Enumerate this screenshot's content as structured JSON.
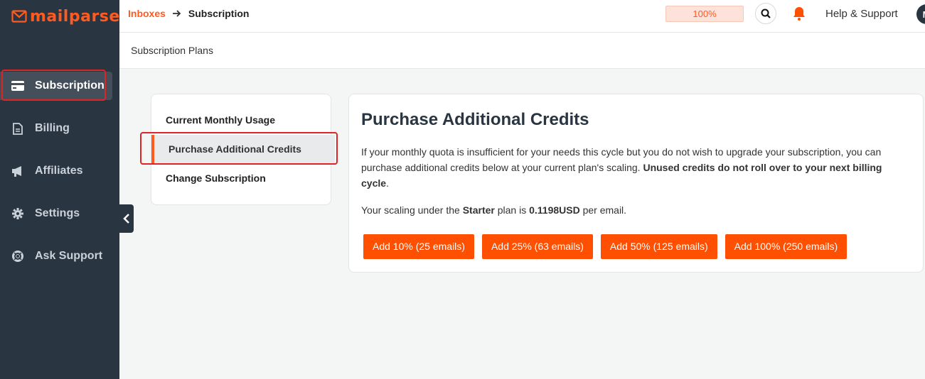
{
  "brand": {
    "logo_text": "mailparser",
    "accent": "#ff5a1f"
  },
  "sidebar": {
    "items": [
      {
        "label": "Subscription",
        "icon": "credit-card-icon",
        "active": true
      },
      {
        "label": "Billing",
        "icon": "document-icon",
        "active": false
      },
      {
        "label": "Affiliates",
        "icon": "megaphone-icon",
        "active": false
      },
      {
        "label": "Settings",
        "icon": "gear-icon",
        "active": false
      },
      {
        "label": "Ask Support",
        "icon": "lifebuoy-icon",
        "active": false
      }
    ],
    "collapse_icon": "chevron-left-icon"
  },
  "header": {
    "breadcrumb": {
      "link": "Inboxes",
      "current": "Subscription"
    },
    "quota": "100%",
    "help": "Help & Support",
    "avatar_initial": "M"
  },
  "subheader": {
    "title": "Subscription Plans"
  },
  "plan_menu": {
    "items": [
      "Current Monthly Usage",
      "Purchase Additional Credits",
      "Change Subscription"
    ],
    "selected": "Purchase Additional Credits"
  },
  "content": {
    "title": "Purchase Additional Credits",
    "desc_1": "If your monthly quota is insufficient for your needs this cycle but you do not wish to upgrade your subscription, you can purchase additional credits below at your current plan's scaling. ",
    "desc_bold": "Unused credits do not roll over to your next billing cycle",
    "desc_end": ".",
    "scale_1": "Your scaling under the ",
    "scale_plan": "Starter",
    "scale_2": " plan is ",
    "scale_price": "0.1198USD",
    "scale_3": " per email.",
    "buttons": [
      "Add 10% (25 emails)",
      "Add 25% (63 emails)",
      "Add 50% (125 emails)",
      "Add 100% (250 emails)"
    ]
  }
}
